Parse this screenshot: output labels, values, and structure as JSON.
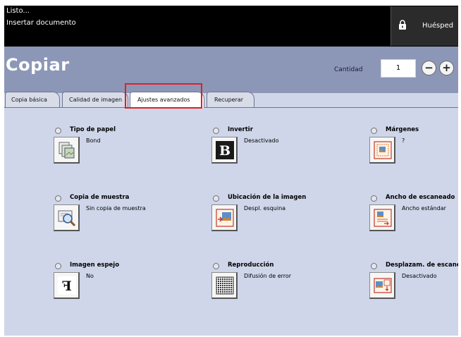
{
  "status": {
    "line1": "Listo...",
    "line2": "Insertar documento"
  },
  "guest": {
    "label": "Huésped",
    "icon": "lock-icon"
  },
  "header": {
    "title": "Copiar",
    "quantity_label": "Cantidad",
    "quantity_value": "1",
    "minus_label": "−",
    "plus_label": "+"
  },
  "tabs": [
    {
      "label": "Copia básica"
    },
    {
      "label": "Calidad de imagen"
    },
    {
      "label": "Ajustes avanzados",
      "selected": true
    },
    {
      "label": "Recuperar"
    }
  ],
  "items": [
    {
      "label": "Tipo de papel",
      "value": "Bond",
      "icon": "paper-type-icon"
    },
    {
      "label": "Invertir",
      "value": "Desactivado",
      "icon": "invert-icon"
    },
    {
      "label": "Márgenes",
      "value": "?",
      "icon": "margins-icon"
    },
    {
      "label": "Copia de muestra",
      "value": "Sin copia de muestra",
      "icon": "sample-copy-icon"
    },
    {
      "label": "Ubicación de la imagen",
      "value": "Despl. esquina",
      "icon": "image-position-icon"
    },
    {
      "label": "Ancho de escaneado",
      "value": "Ancho estándar",
      "icon": "scan-width-icon"
    },
    {
      "label": "Imagen espejo",
      "value": "No",
      "icon": "mirror-image-icon"
    },
    {
      "label": "Reproducción",
      "value": "Difusión de error",
      "icon": "reproduction-icon"
    },
    {
      "label": "Desplazam. de escaneado",
      "value": "Desactivado",
      "icon": "scan-shift-icon"
    }
  ],
  "invert_glyph": "B",
  "mirror_glyph": "F",
  "colors": {
    "header": "#8c97b7",
    "content": "#cfd6ea",
    "highlight": "#e02020"
  }
}
